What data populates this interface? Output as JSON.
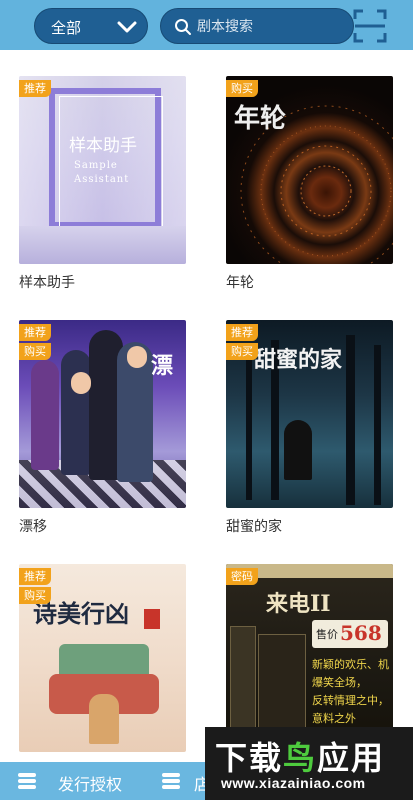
{
  "header": {
    "category_label": "全部",
    "search_placeholder": "剧本搜索"
  },
  "scripts": [
    {
      "title": "样本助手",
      "badges": [
        "推荐"
      ],
      "cover_text": "样本助手",
      "cover_subtitle_line1": "Sample",
      "cover_subtitle_line2": "Assistant"
    },
    {
      "title": "年轮",
      "badges": [
        "购买"
      ],
      "cover_text": "年轮"
    },
    {
      "title": "漂移",
      "badges": [
        "推荐",
        "购买"
      ],
      "cover_text": "漂"
    },
    {
      "title": "甜蜜的家",
      "badges": [
        "推荐",
        "购买"
      ],
      "cover_text": "甜蜜的家"
    },
    {
      "title": "",
      "badges": [
        "推荐",
        "购买"
      ],
      "cover_text": "诗美行凶"
    },
    {
      "title": "",
      "badges": [
        "密码"
      ],
      "cover_text": "来电II",
      "cover_price_label": "售价",
      "cover_price": "568",
      "cover_lines": [
        "新颖的欢乐、机",
        "爆笑全场，",
        "反转情理之中，",
        "意料之外"
      ]
    }
  ],
  "bottom_nav": {
    "tab1_label": "发行授权",
    "tab2_label": "店"
  },
  "watermark": {
    "part1": "下载",
    "part2": "鸟",
    "part3": "应用",
    "url": "www.xiazainiao.com"
  }
}
